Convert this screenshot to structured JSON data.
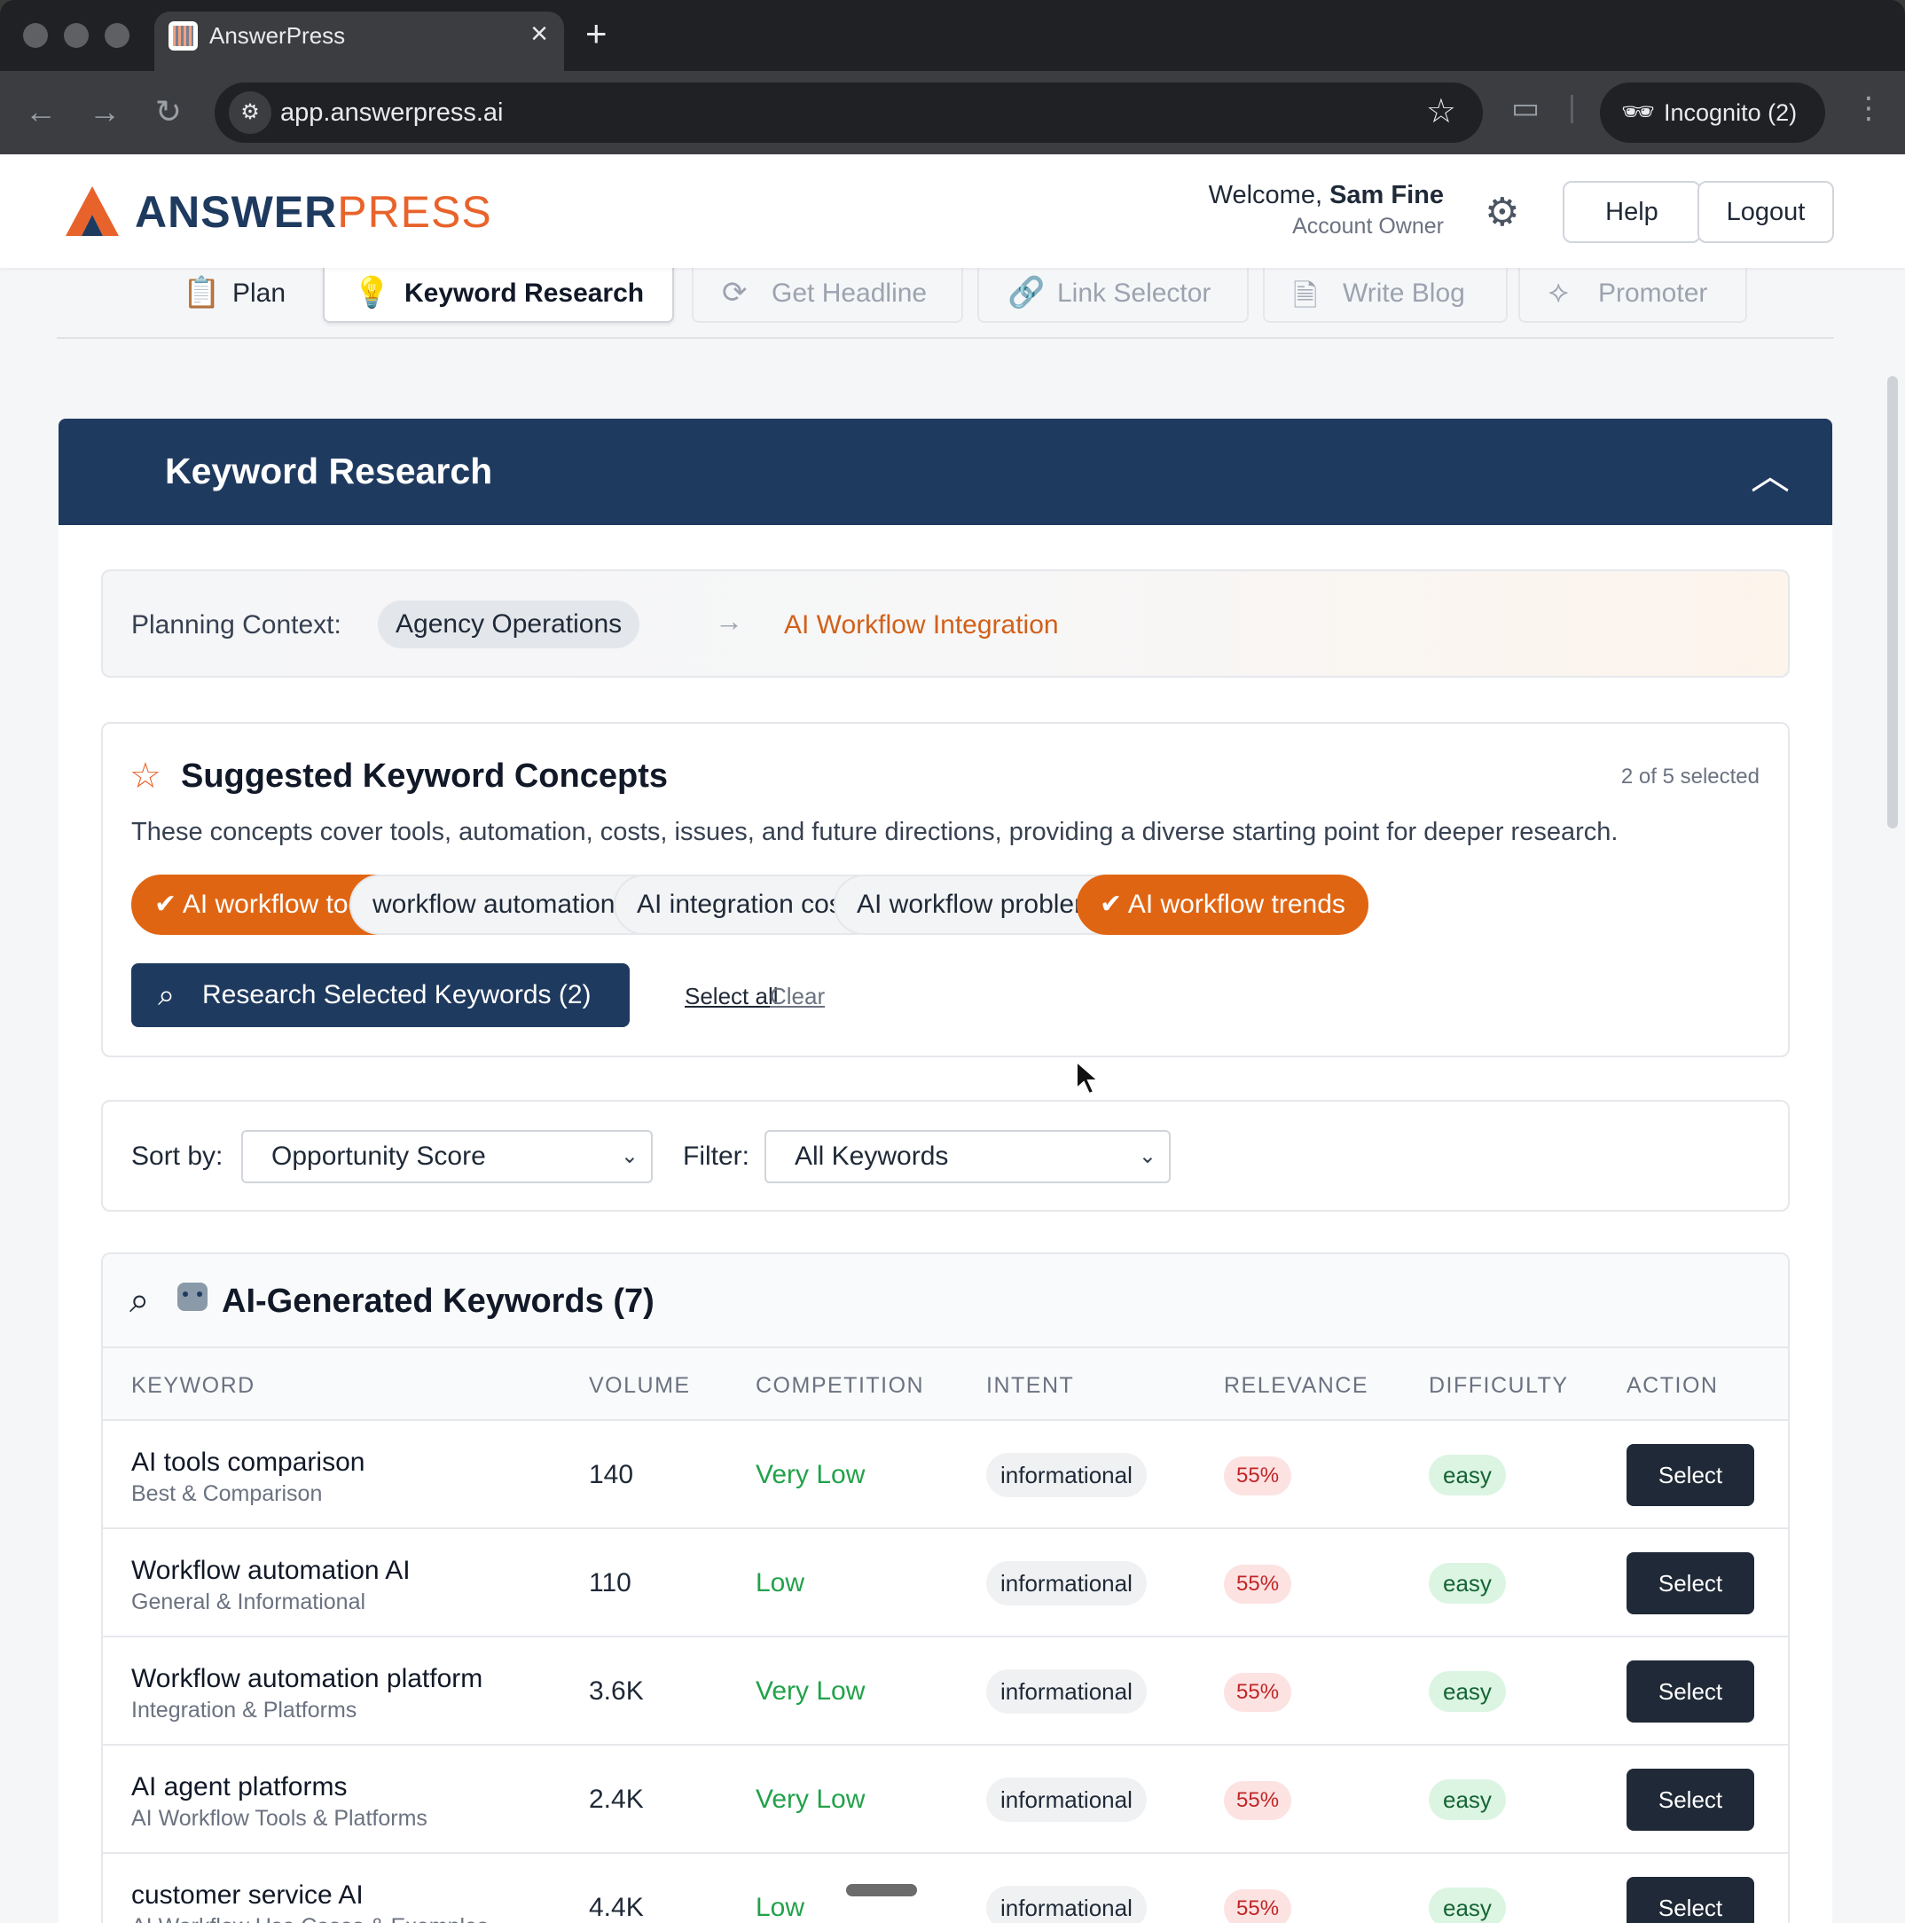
{
  "browser": {
    "tab_title": "AnswerPress",
    "url": "app.answerpress.ai",
    "incognito_label": "Incognito (2)"
  },
  "header": {
    "logo_part1": "ANSWER",
    "logo_part2": "PRESS",
    "welcome_prefix": "Welcome,",
    "user_name": "Sam Fine",
    "user_role": "Account Owner",
    "help_label": "Help",
    "logout_label": "Logout"
  },
  "steps": [
    {
      "label": "Plan",
      "state": "done",
      "icon": "clipboard-icon"
    },
    {
      "label": "Keyword Research",
      "state": "active",
      "icon": "lightbulb-icon"
    },
    {
      "label": "Get Headline",
      "state": "disabled",
      "icon": "refresh-icon"
    },
    {
      "label": "Link Selector",
      "state": "disabled",
      "icon": "link-icon"
    },
    {
      "label": "Write Blog",
      "state": "disabled",
      "icon": "document-icon"
    },
    {
      "label": "Promoter",
      "state": "disabled",
      "icon": "share-icon"
    }
  ],
  "panel": {
    "title": "Keyword Research"
  },
  "context": {
    "label": "Planning Context:",
    "pillar": "Agency Operations",
    "arrow": "→",
    "topic": "AI Workflow Integration"
  },
  "concepts": {
    "title": "Suggested Keyword Concepts",
    "count_text": "2 of 5 selected",
    "description": "These concepts cover tools, automation, costs, issues, and future directions, providing a diverse starting point for deeper research.",
    "chips": [
      {
        "label": "✔ AI workflow tools",
        "selected": true
      },
      {
        "label": "workflow automation AI",
        "selected": false
      },
      {
        "label": "AI integration costs",
        "selected": false
      },
      {
        "label": "AI workflow problems",
        "selected": false
      },
      {
        "label": "✔ AI workflow trends",
        "selected": true
      }
    ],
    "research_button": "Research Selected Keywords (2)",
    "select_all": "Select all",
    "clear": "Clear"
  },
  "filters": {
    "sort_label": "Sort by:",
    "sort_value": "Opportunity Score",
    "filter_label": "Filter:",
    "filter_value": "All Keywords"
  },
  "keywords": {
    "title": "AI-Generated Keywords (7)",
    "columns": [
      "KEYWORD",
      "VOLUME",
      "COMPETITION",
      "INTENT",
      "RELEVANCE",
      "DIFFICULTY",
      "ACTION"
    ],
    "rows": [
      {
        "keyword": "AI tools comparison",
        "category": "Best & Comparison",
        "volume": "140",
        "competition": "Very Low",
        "intent": "informational",
        "relevance": "55%",
        "difficulty": "easy",
        "action": "Select"
      },
      {
        "keyword": "Workflow automation AI",
        "category": "General & Informational",
        "volume": "110",
        "competition": "Low",
        "intent": "informational",
        "relevance": "55%",
        "difficulty": "easy",
        "action": "Select"
      },
      {
        "keyword": "Workflow automation platform",
        "category": "Integration & Platforms",
        "volume": "3.6K",
        "competition": "Very Low",
        "intent": "informational",
        "relevance": "55%",
        "difficulty": "easy",
        "action": "Select"
      },
      {
        "keyword": "AI agent platforms",
        "category": "AI Workflow Tools & Platforms",
        "volume": "2.4K",
        "competition": "Very Low",
        "intent": "informational",
        "relevance": "55%",
        "difficulty": "easy",
        "action": "Select"
      },
      {
        "keyword": "customer service AI",
        "category": "AI Workflow Use Cases & Examples",
        "volume": "4.4K",
        "competition": "Low",
        "intent": "informational",
        "relevance": "55%",
        "difficulty": "easy",
        "action": "Select"
      }
    ]
  },
  "colors": {
    "brand_navy": "#1f3a5f",
    "brand_orange": "#e06512",
    "competition_green": "#22a24a"
  }
}
